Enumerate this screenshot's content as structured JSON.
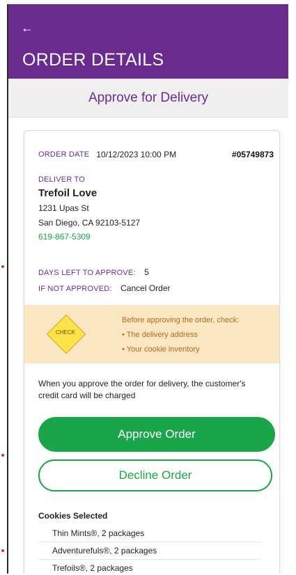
{
  "header": {
    "back_icon": "arrow-left-icon",
    "title": "ORDER DETAILS"
  },
  "subheader": {
    "title": "Approve for Delivery"
  },
  "order": {
    "date_label": "ORDER DATE",
    "date_value": "10/12/2023 10:00 PM",
    "order_number": "#05749873"
  },
  "delivery": {
    "label": "DELIVER TO",
    "name": "Trefoil Love",
    "address_line1": "1231 Upas St",
    "address_line2": "San Diego, CA 92103-5127",
    "phone": "619-867-5309"
  },
  "approval": {
    "days_left_label": "DAYS LEFT TO APPROVE:",
    "days_left_value": "5",
    "if_not_label": "IF NOT APPROVED:",
    "if_not_value": "Cancel Order"
  },
  "check": {
    "badge": "CHECK",
    "heading": "Before approving the order, check:",
    "items": [
      "• The delivery address",
      "• Your cookie inventory"
    ],
    "colors": {
      "band": "#fbe6c2",
      "diamond": "#fde24a",
      "text": "#b16a1d"
    }
  },
  "notice": "When you approve the order for delivery, the customer's credit card will be charged",
  "actions": {
    "approve_label": "Approve Order",
    "decline_label": "Decline Order"
  },
  "cookies": {
    "title": "Cookies Selected",
    "items": [
      "Thin Mints®, 2 packages",
      "Adventurefuls®, 2 packages",
      "Trefoils®, 2 packages"
    ]
  },
  "colors": {
    "brand_purple": "#6a2b8f",
    "accent_green": "#1aa54a"
  }
}
